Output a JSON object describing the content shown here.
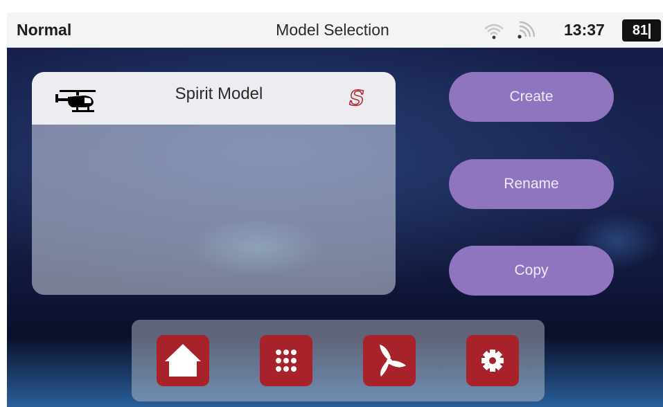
{
  "statusbar": {
    "profile": "Normal",
    "title": "Model Selection",
    "wifi_icon": "wifi-icon",
    "signal_icon": "signal-icon",
    "time": "13:37",
    "battery": "81"
  },
  "model_list": {
    "items": [
      {
        "name": "Spirit Model",
        "type_icon": "helicopter-icon",
        "badge_icon": "spirit-s-icon"
      }
    ]
  },
  "actions": {
    "create": "Create",
    "rename": "Rename",
    "copy": "Copy"
  },
  "dock": {
    "items": [
      {
        "icon": "home-icon"
      },
      {
        "icon": "apps-grid-icon"
      },
      {
        "icon": "fan-icon"
      },
      {
        "icon": "gear-icon"
      }
    ]
  },
  "colors": {
    "button_purple": "#8f74c0",
    "dock_red": "#a8222b",
    "status_bg": "#f4f4f4"
  }
}
